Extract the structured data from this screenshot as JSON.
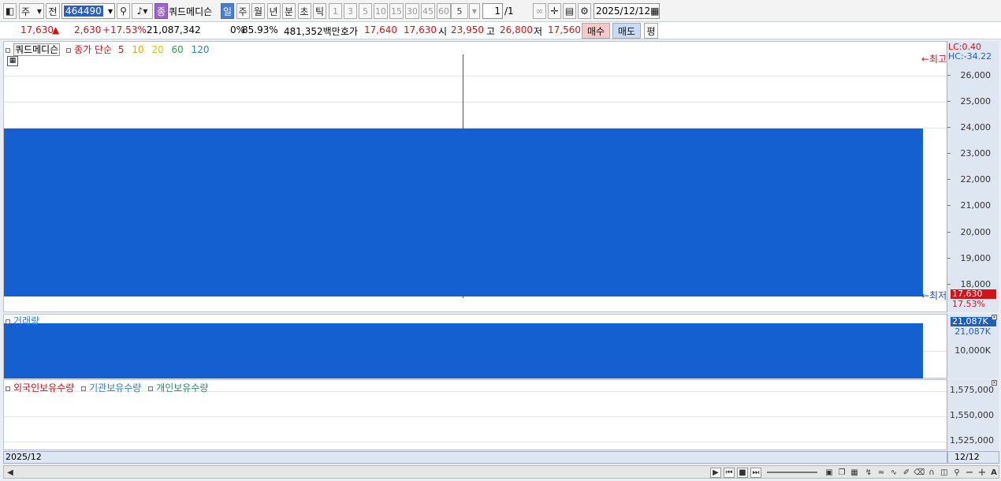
{
  "toolbar": {
    "market_type": "주",
    "prev_btn": "전",
    "stock_code": "464490",
    "badge": "종",
    "stock_name": "쿼드메디슨",
    "periods": [
      "일",
      "주",
      "월",
      "년",
      "분",
      "초",
      "틱"
    ],
    "active_period": "일",
    "intervals": [
      "1",
      "3",
      "5",
      "10",
      "15",
      "30",
      "45",
      "60"
    ],
    "count_value": "5",
    "page_value": "1",
    "page_total": "/1",
    "date": "2025/12/12"
  },
  "quote": {
    "price": "17,630",
    "change": "2,630",
    "change_pct": "+17.53%",
    "volume": "21,087,342",
    "pct0": "0%",
    "turnover": "85.93%",
    "amount": "481,352백만",
    "bid_label": "호가",
    "bid1": "17,640",
    "bid2": "17,630",
    "open_label": "시",
    "open": "23,950",
    "high_label": "고",
    "high": "26,800",
    "low_label": "저",
    "low": "17,560",
    "buy_btn": "매수",
    "sell_btn": "매도",
    "eval_btn": "평"
  },
  "price_panel": {
    "name": "쿼드메디슨",
    "legend_label": "종가 단순",
    "ma": [
      "5",
      "10",
      "20",
      "60",
      "120"
    ],
    "lc": "LC:0.40",
    "hc": "HC:-34.22",
    "ticks": [
      "26,000",
      "25,000",
      "24,000",
      "23,000",
      "22,000",
      "21,000",
      "20,000",
      "19,000",
      "18,000"
    ],
    "high_marker": "←최고",
    "low_marker": "←최저",
    "last_price": "17,630",
    "last_pct": "17.53%"
  },
  "volume_panel": {
    "name": "거래량",
    "current": "21,087K",
    "ticks": [
      "21,087K",
      "10,000K"
    ]
  },
  "holding_panel": {
    "legend": [
      "외국인보유수량",
      "기관보유수량",
      "개인보유수량"
    ],
    "ticks": [
      "1,575,000",
      "1,550,000",
      "1,525,000"
    ]
  },
  "xaxis": {
    "left_label": "2025/12",
    "right_label": "12/12"
  },
  "colors": {
    "candle": "#1560d0",
    "up": "#d3131a",
    "down": "#1f3fd0",
    "ma5": "#d3131a",
    "ma10": "#e8a400",
    "ma20": "#d8c800",
    "ma60": "#2aa24a",
    "ma120": "#2f7fbf"
  }
}
